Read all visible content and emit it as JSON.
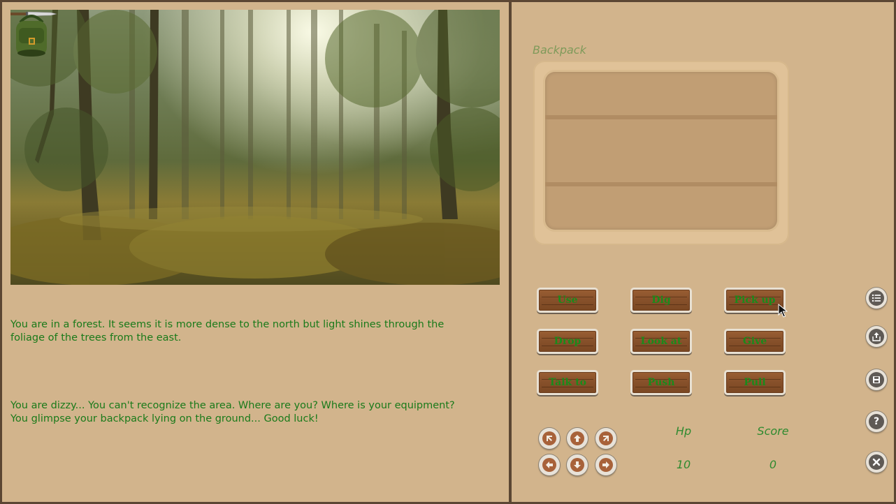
{
  "scene": {
    "items": {
      "knife_icon": "knife-icon",
      "backpack_icon": "backpack-icon"
    }
  },
  "messages": [
    "You are in a forest. It seems it is more dense to the north but light shines through the\nfoliage of the trees from the east.",
    "You are dizzy... You can't recognize the area. Where are you? Where is your equipment?\nYou glimpse your backpack lying on the ground... Good luck!"
  ],
  "backpack": {
    "label": "Backpack"
  },
  "verbs": [
    "Use",
    "Dig",
    "Pick up",
    "Drop",
    "Look at",
    "Give",
    "Talk to",
    "Push",
    "Pull"
  ],
  "navigation": {
    "icons": [
      "arrow-up-left-icon",
      "arrow-up-icon",
      "arrow-up-right-icon",
      "arrow-left-icon",
      "arrow-down-icon",
      "arrow-right-icon"
    ]
  },
  "stats": {
    "hp_label": "Hp",
    "hp_value": "10",
    "score_label": "Score",
    "score_value": "0"
  },
  "side_menu": {
    "icons": [
      "list-icon",
      "load-icon",
      "save-icon",
      "help-icon",
      "close-icon"
    ]
  },
  "colors": {
    "background": "#d2b48c",
    "text_green": "#1a7a1a",
    "frame": "#5b4633",
    "button_wood": "#86502a"
  }
}
